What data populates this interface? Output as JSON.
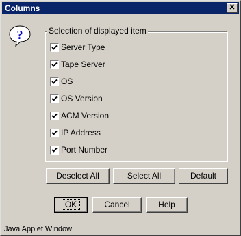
{
  "window": {
    "title": "Columns",
    "close_label": "✕"
  },
  "group": {
    "label": "Selection of displayed item"
  },
  "items": [
    {
      "label": "Server Type",
      "checked": true
    },
    {
      "label": "Tape Server",
      "checked": true
    },
    {
      "label": "OS",
      "checked": true
    },
    {
      "label": "OS Version",
      "checked": true
    },
    {
      "label": "ACM Version",
      "checked": true
    },
    {
      "label": "IP Address",
      "checked": true
    },
    {
      "label": "Port Number",
      "checked": true
    }
  ],
  "selection_buttons": {
    "deselect_all": "Deselect All",
    "select_all": "Select All",
    "default": "Default"
  },
  "dialog_buttons": {
    "ok": "OK",
    "cancel": "Cancel",
    "help": "Help"
  },
  "status": {
    "text": "Java Applet Window"
  }
}
